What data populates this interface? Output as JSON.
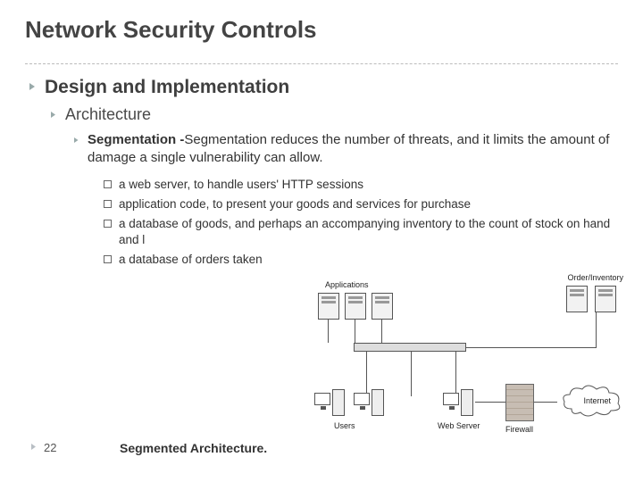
{
  "title": "Network Security Controls",
  "h1": "Design and Implementation",
  "h2": "Architecture",
  "seg_label": "Segmentation -",
  "seg_body": "Segmentation reduces the number of threats, and it limits the amount of damage a single vulnerability can allow.",
  "items": [
    "a web server, to handle users' HTTP sessions",
    "application code, to present your goods and services for purchase",
    "a database of goods, and perhaps an accompanying inventory to the count of stock on hand and l",
    "a database of orders taken"
  ],
  "caption": "Segmented Architecture.",
  "page": "22",
  "diagram": {
    "applications": "Applications",
    "orderinv": "Order/Inventory",
    "users": "Users",
    "webserver": "Web Server",
    "firewall": "Firewall",
    "internet": "Internet"
  }
}
